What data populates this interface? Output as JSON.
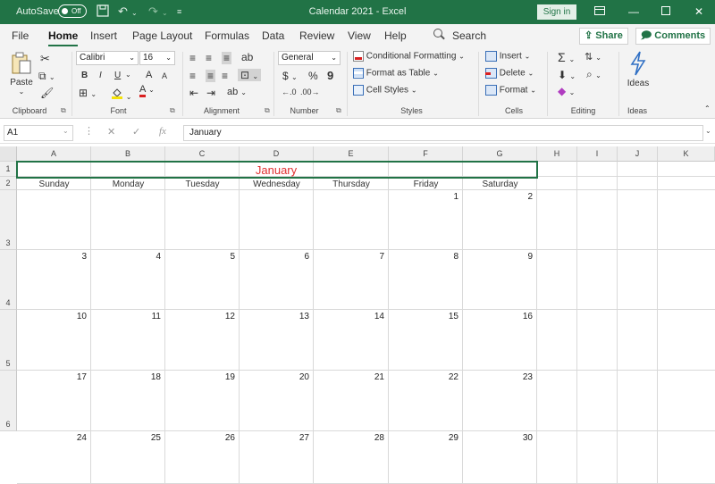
{
  "window": {
    "autosave_label": "AutoSave",
    "autosave_state": "Off",
    "title": "Calendar 2021 - Excel",
    "signin_label": "Sign in",
    "accent": "#217346"
  },
  "menu": {
    "tabs": [
      "File",
      "Home",
      "Insert",
      "Page Layout",
      "Formulas",
      "Data",
      "Review",
      "View",
      "Help"
    ],
    "active": "Home",
    "search_label": "Search",
    "share_label": "Share",
    "comments_label": "Comments"
  },
  "ribbon": {
    "clipboard": {
      "paste_label": "Paste",
      "group_label": "Clipboard"
    },
    "font": {
      "name": "Calibri",
      "size": "16",
      "bold": "B",
      "italic": "I",
      "underline": "U",
      "grow": "A",
      "shrink": "A",
      "group_label": "Font"
    },
    "alignment": {
      "group_label": "Alignment"
    },
    "number": {
      "format": "General",
      "currency": "$",
      "percent": "%",
      "comma": "9",
      "group_label": "Number"
    },
    "styles": {
      "conditional": "Conditional Formatting",
      "format_table": "Format as Table",
      "cell_styles": "Cell Styles",
      "group_label": "Styles"
    },
    "cells": {
      "insert": "Insert",
      "delete": "Delete",
      "format": "Format",
      "group_label": "Cells"
    },
    "editing": {
      "group_label": "Editing"
    },
    "ideas": {
      "label": "Ideas",
      "group_label": "Ideas"
    }
  },
  "formula_bar": {
    "name_box": "A1",
    "content": "January"
  },
  "sheet": {
    "columns": [
      "A",
      "B",
      "C",
      "D",
      "E",
      "F",
      "G",
      "H",
      "I",
      "J",
      "K"
    ],
    "rows": [
      "1",
      "2",
      "3",
      "4",
      "5",
      "6"
    ],
    "month_title": "January",
    "month_color": "#e03030",
    "day_names": [
      "Sunday",
      "Monday",
      "Tuesday",
      "Wednesday",
      "Thursday",
      "Friday",
      "Saturday"
    ],
    "weeks": [
      [
        "",
        "",
        "",
        "",
        "",
        "1",
        "2"
      ],
      [
        "3",
        "4",
        "5",
        "6",
        "7",
        "8",
        "9"
      ],
      [
        "10",
        "11",
        "12",
        "13",
        "14",
        "15",
        "16"
      ],
      [
        "17",
        "18",
        "19",
        "20",
        "21",
        "22",
        "23"
      ],
      [
        "24",
        "25",
        "26",
        "27",
        "28",
        "29",
        "30"
      ]
    ]
  }
}
